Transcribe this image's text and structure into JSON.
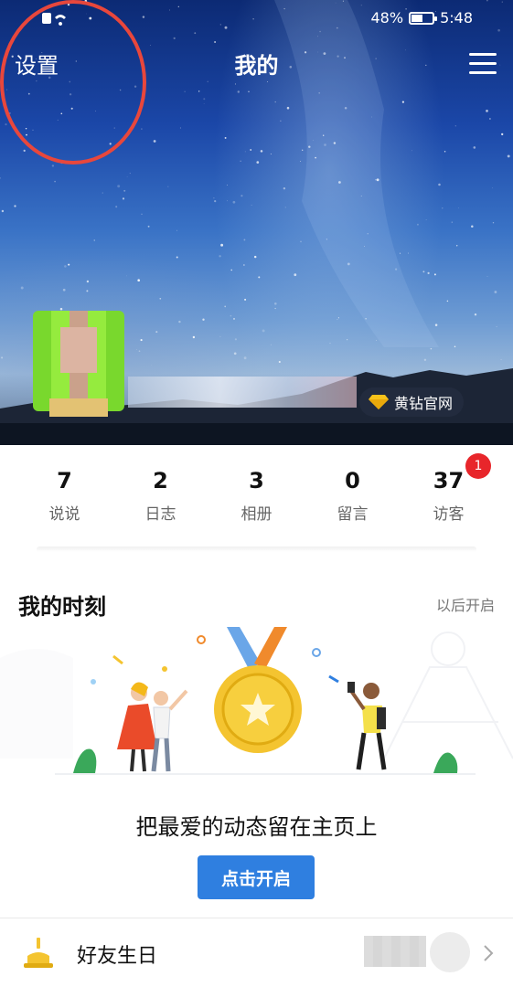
{
  "status_bar": {
    "battery": "48%",
    "time": "5:48",
    "battery_level": 0.48
  },
  "header": {
    "settings": "设置",
    "title": "我的"
  },
  "hero": {
    "vip_link": "黄钻官网"
  },
  "stats": [
    {
      "value": "7",
      "label": "说说"
    },
    {
      "value": "2",
      "label": "日志"
    },
    {
      "value": "3",
      "label": "相册"
    },
    {
      "value": "0",
      "label": "留言"
    },
    {
      "value": "37",
      "label": "访客",
      "badge": "1"
    }
  ],
  "moments": {
    "title": "我的时刻",
    "later": "以后开启",
    "description": "把最爱的动态留在主页上",
    "button": "点击开启"
  },
  "birthday": {
    "label": "好友生日"
  },
  "colors": {
    "accent": "#2f7fe0",
    "badge": "#e8262b",
    "highlight": "#e8473c"
  }
}
